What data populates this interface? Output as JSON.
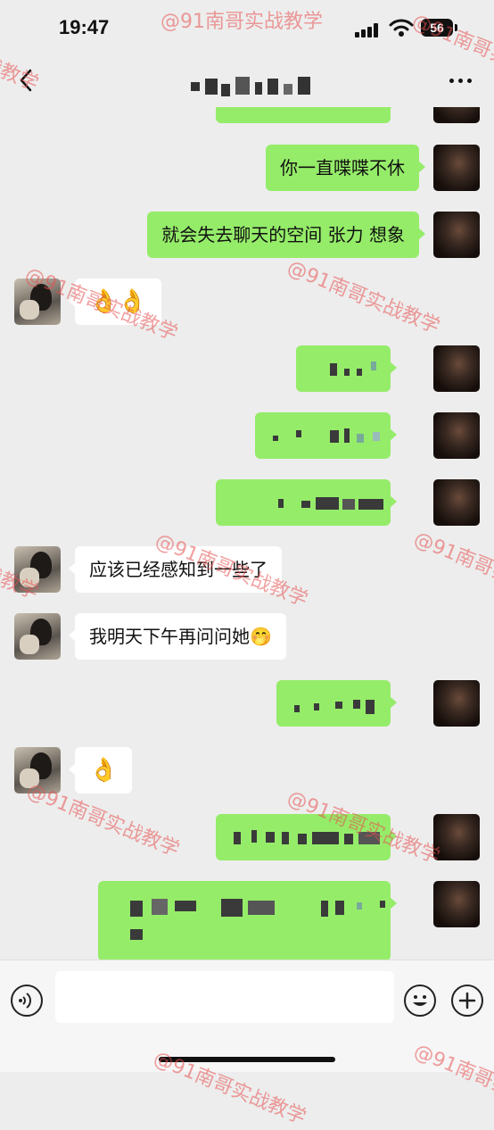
{
  "status_bar": {
    "time": "19:47",
    "battery": "56"
  },
  "messages": {
    "m2": "你一直喋喋不休",
    "m3": "就会失去聊天的空间 张力 想象",
    "m4": "👌👌",
    "m8": "应该已经感知到一些了",
    "m9": "我明天下午再问问她🤭",
    "m11": "👌"
  },
  "watermark": "@91南哥实战教学",
  "colors": {
    "sent_bubble": "#95ec69",
    "received_bubble": "#ffffff",
    "chat_bg": "#ededed",
    "watermark": "#e85050"
  },
  "icons": [
    "back-icon",
    "more-icon",
    "voice-icon",
    "emoji-icon",
    "plus-icon"
  ]
}
